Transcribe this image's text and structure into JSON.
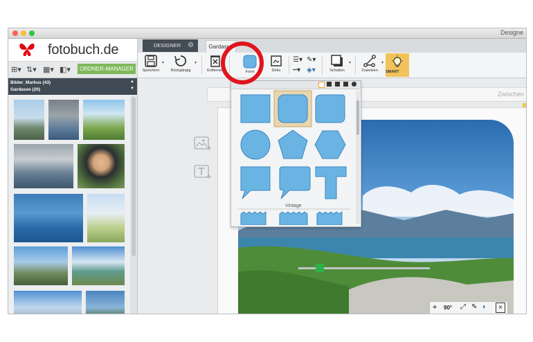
{
  "window": {
    "title": "Designe"
  },
  "brand": {
    "name": "fotobuch.de",
    "logo_color": "#e30613"
  },
  "left": {
    "folder_button": "ORDNER-MANAGER",
    "albums": [
      "Bilder_Markus (43)",
      "Gardasee (20)"
    ]
  },
  "tabs": {
    "designer": "DESIGNER",
    "project": "Gardasee"
  },
  "toolbar": {
    "save": "Speichern",
    "undo": "Rückgängig",
    "remove": "Entfernen",
    "shape": "Form",
    "deco": "Deko",
    "shadow": "Schatten",
    "assign": "Zuweisen",
    "smart": "SMART"
  },
  "canvas": {
    "title_field": "Zwischen"
  },
  "shapes": {
    "section_label": "Vintage"
  },
  "image_tools": {
    "rotate": "90°"
  },
  "colors": {
    "accent_green": "#7db85a",
    "highlight_red": "#e0141e",
    "shape_blue": "#6ab4e4",
    "smart_yellow": "#f2c35a",
    "dark_tab": "#444c55"
  },
  "icons": [
    "save-icon",
    "undo-icon",
    "remove-icon",
    "shape-icon",
    "deco-icon",
    "shadow-icon",
    "assign-icon",
    "lightbulb-icon",
    "add-image-icon",
    "add-text-icon",
    "crop-target-icon",
    "eyedropper-icon",
    "close-icon"
  ]
}
